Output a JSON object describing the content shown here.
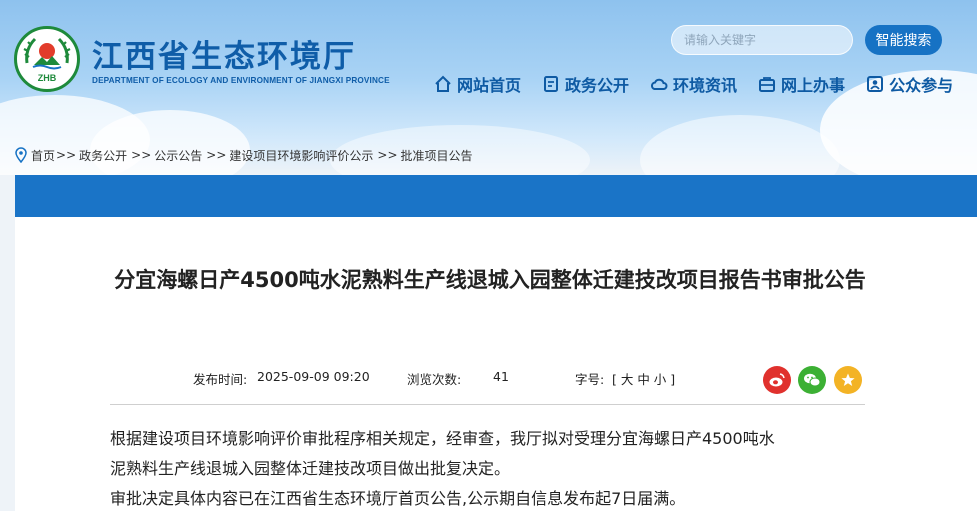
{
  "header": {
    "org_title": "江西省生态环境厅",
    "org_subtitle": "DEPARTMENT OF ECOLOGY AND ENVIRONMENT OF JIANGXI PROVINCE",
    "logo_text": "ZHB",
    "search_placeholder": "请输入关键字",
    "search_button": "智能搜索"
  },
  "nav": {
    "items": [
      {
        "label": "网站首页",
        "icon": "home-icon"
      },
      {
        "label": "政务公开",
        "icon": "document-icon"
      },
      {
        "label": "环境资讯",
        "icon": "cloud-icon"
      },
      {
        "label": "网上办事",
        "icon": "briefcase-icon"
      },
      {
        "label": "公众参与",
        "icon": "people-icon"
      }
    ]
  },
  "breadcrumb": {
    "items": [
      "首页",
      "政务公开",
      "公示公告",
      "建设项目环境影响评价公示",
      "批准项目公告"
    ],
    "separator": ">>"
  },
  "article": {
    "title": "分宜海螺日产4500吨水泥熟料生产线退城入园整体迁建技改项目报告书审批公告",
    "publish_label": "发布时间:",
    "publish_time": "2025-09-09 09:20",
    "views_label": "浏览次数:",
    "views": "41",
    "font_label": "字号:",
    "font_sizes": "[ 大 中 小 ]",
    "paragraphs": [
      "根据建设项目环境影响评价审批程序相关规定，经审查，我厅拟对受理分宜海螺日产4500吨水",
      "泥熟料生产线退城入园整体迁建技改项目做出批复决定。",
      "审批决定具体内容已在江西省生态环境厅首页公告,公示期自信息发布起7日届满。"
    ]
  },
  "share": [
    {
      "icon": "weibo-icon",
      "color": "#e0312d"
    },
    {
      "icon": "wechat-icon",
      "color": "#3cb034"
    },
    {
      "icon": "favorite-icon",
      "color": "#f3b325"
    }
  ]
}
